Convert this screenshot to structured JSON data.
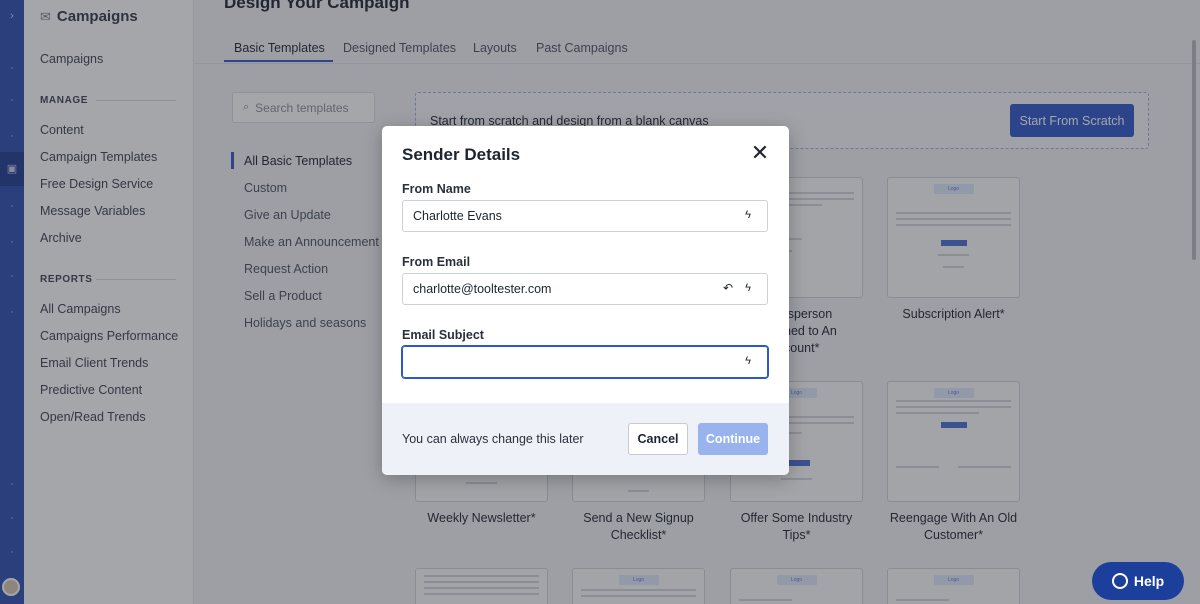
{
  "sidebar": {
    "header": "Campaigns",
    "campaigns_link": "Campaigns",
    "manage_section": "MANAGE",
    "manage_items": [
      "Content",
      "Campaign Templates",
      "Free Design Service",
      "Message Variables",
      "Archive"
    ],
    "reports_section": "REPORTS",
    "report_items": [
      "All Campaigns",
      "Campaigns Performance",
      "Email Client Trends",
      "Predictive Content",
      "Open/Read Trends"
    ]
  },
  "main": {
    "title": "Design Your Campaign",
    "tabs": [
      "Basic Templates",
      "Designed Templates",
      "Layouts",
      "Past Campaigns"
    ],
    "search_placeholder": "Search templates",
    "categories": [
      "All Basic Templates",
      "Custom",
      "Give an Update",
      "Make an Announcement",
      "Request Action",
      "Sell a Product",
      "Holidays and seasons"
    ],
    "scratch_text": "Start from scratch and design from a blank canvas",
    "scratch_button": "Start From Scratch",
    "card_logo": "Logo",
    "template_labels": {
      "row1_a": "lesperson",
      "row1_b": "ned to An",
      "row1_c": "count*",
      "subscription": "Subscription Alert*",
      "weekly": "Weekly Newsletter*",
      "signup": "Send a New Signup Checklist*",
      "offer": "Offer Some Industry Tips*",
      "reengage": "Reengage With An Old Customer*"
    }
  },
  "modal": {
    "title": "Sender Details",
    "from_name_label": "From Name",
    "from_name_value": "Charlotte Evans",
    "from_email_label": "From Email",
    "from_email_value": "charlotte@tooltester.com",
    "subject_label": "Email Subject",
    "subject_value": "",
    "footer_note": "You can always change this later",
    "cancel": "Cancel",
    "continue": "Continue"
  },
  "help": {
    "label": "Help"
  },
  "colors": {
    "accent": "#2e57c9",
    "rail": "#2d4fb1",
    "help": "#1d3f9c",
    "continue_disabled": "#98b3ee"
  }
}
